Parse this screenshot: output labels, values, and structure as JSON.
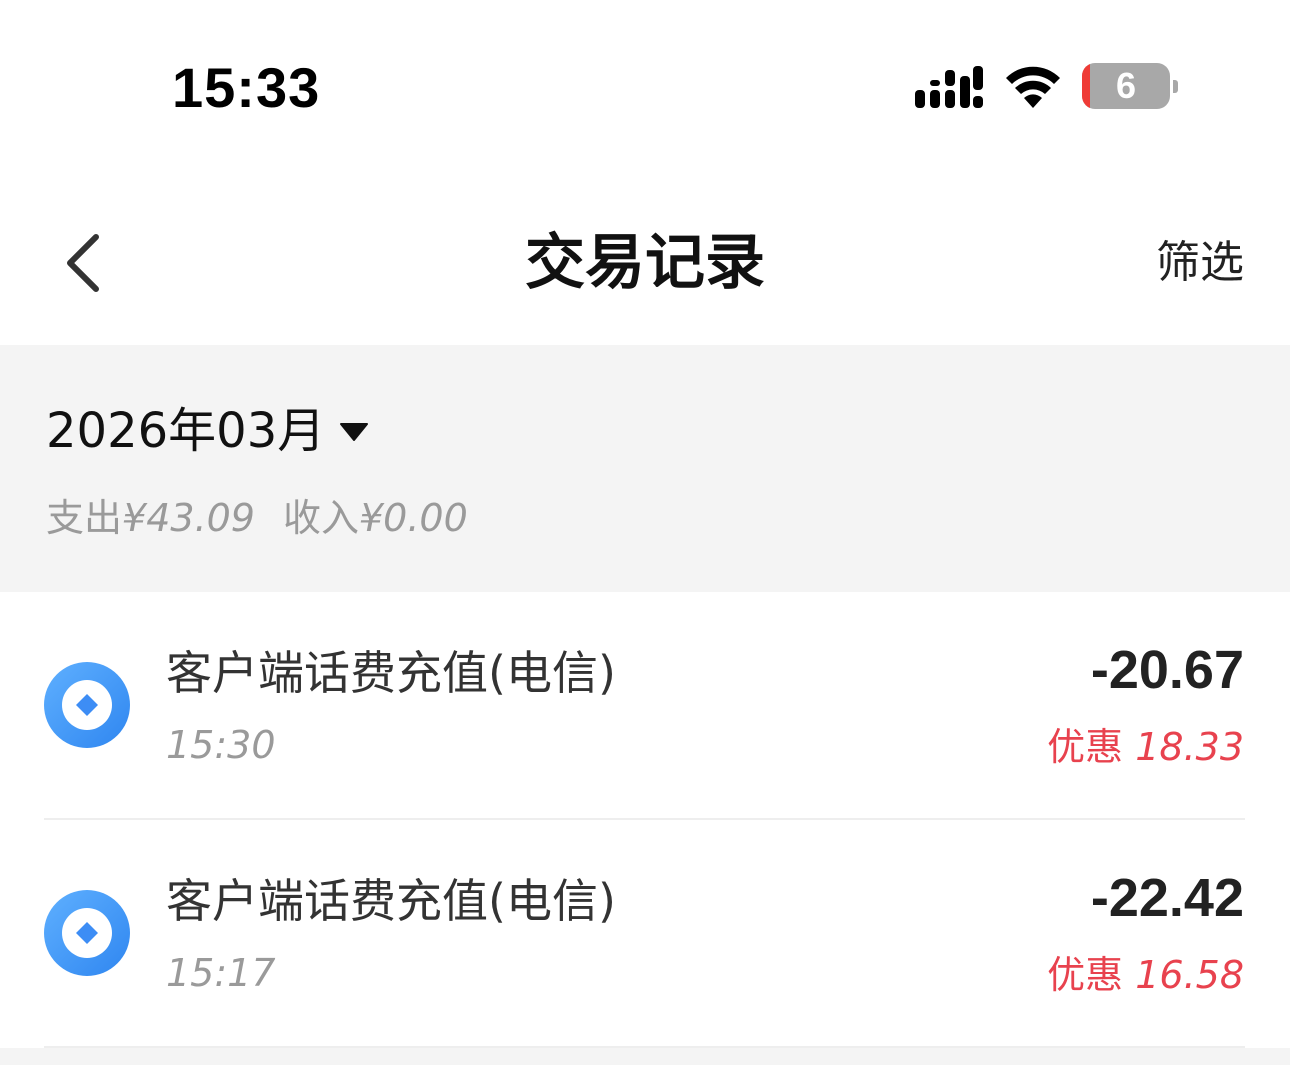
{
  "status_bar": {
    "time": "15:33",
    "battery_level": "6",
    "icons": [
      "signal-icon",
      "wifi-icon",
      "battery-icon"
    ]
  },
  "nav": {
    "title": "交易记录",
    "filter_label": "筛选",
    "back_icon": "chevron-left-icon"
  },
  "summary": {
    "month": "2026年03月",
    "expense_label": "支出",
    "expense_value": "¥43.09",
    "income_label": "收入",
    "income_value": "¥0.00"
  },
  "transactions": [
    {
      "title": "客户端话费充值(电信)",
      "time": "15:30",
      "amount": "-20.67",
      "discount_label": "优惠",
      "discount_value": "18.33"
    },
    {
      "title": "客户端话费充值(电信)",
      "time": "15:17",
      "amount": "-22.42",
      "discount_label": "优惠",
      "discount_value": "16.58"
    }
  ],
  "colors": {
    "accent_blue": "#3d8df5",
    "discount_red": "#e8424e",
    "battery_low": "#ef3b36",
    "summary_bg": "#f4f4f4"
  }
}
